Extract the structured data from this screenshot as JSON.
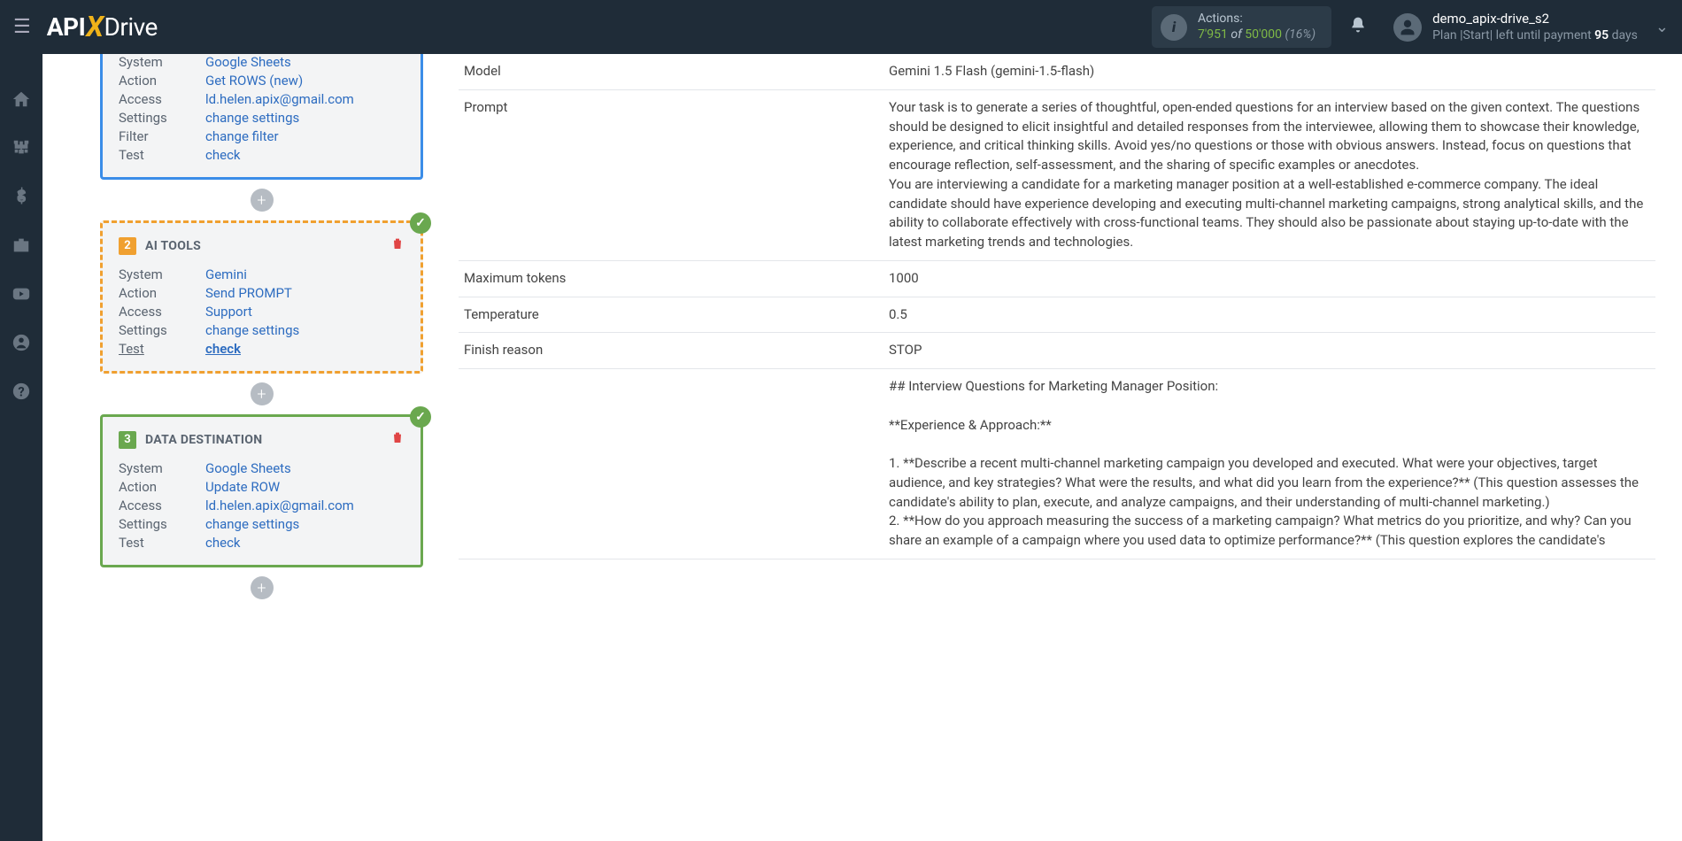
{
  "header": {
    "actions_label": "Actions:",
    "actions_used": "7'951",
    "actions_of": " of ",
    "actions_total": "50'000",
    "actions_pct": " (16%)",
    "user_name": "demo_apix-drive_s2",
    "user_plan_prefix": "Plan |Start| left until payment ",
    "user_plan_days": "95",
    "user_plan_suffix": " days"
  },
  "cards": {
    "c1": {
      "system_label": "System",
      "system_value": "Google Sheets",
      "action_label": "Action",
      "action_value": "Get ROWS (new)",
      "access_label": "Access",
      "access_value": "ld.helen.apix@gmail.com",
      "settings_label": "Settings",
      "settings_value": "change settings",
      "filter_label": "Filter",
      "filter_value": "change filter",
      "test_label": "Test",
      "test_value": "check"
    },
    "c2": {
      "num": "2",
      "title": "AI TOOLS",
      "system_label": "System",
      "system_value": "Gemini",
      "action_label": "Action",
      "action_value": "Send PROMPT",
      "access_label": "Access",
      "access_value": "Support",
      "settings_label": "Settings",
      "settings_value": "change settings",
      "test_label": "Test",
      "test_value": "check"
    },
    "c3": {
      "num": "3",
      "title": "DATA DESTINATION",
      "system_label": "System",
      "system_value": "Google Sheets",
      "action_label": "Action",
      "action_value": "Update ROW",
      "access_label": "Access",
      "access_value": "ld.helen.apix@gmail.com",
      "settings_label": "Settings",
      "settings_value": "change settings",
      "test_label": "Test",
      "test_value": "check"
    }
  },
  "details": {
    "model_label": "Model",
    "model_value": "Gemini 1.5 Flash (gemini-1.5-flash)",
    "prompt_label": "Prompt",
    "prompt_value": "Your task is to generate a series of thoughtful, open-ended questions for an interview based on the given context. The questions should be designed to elicit insightful and detailed responses from the interviewee, allowing them to showcase their knowledge, experience, and critical thinking skills. Avoid yes/no questions or those with obvious answers. Instead, focus on questions that encourage reflection, self-assessment, and the sharing of specific examples or anecdotes.\nYou are interviewing a candidate for a marketing manager position at a well-established e-commerce company. The ideal candidate should have experience developing and executing multi-channel marketing campaigns, strong analytical skills, and the ability to collaborate effectively with cross-functional teams. They should also be passionate about staying up-to-date with the latest marketing trends and technologies.",
    "max_tokens_label": "Maximum tokens",
    "max_tokens_value": "1000",
    "temp_label": "Temperature",
    "temp_value": "0.5",
    "finish_label": "Finish reason",
    "finish_value": "STOP",
    "result_text": "## Interview Questions for Marketing Manager Position:\n\n**Experience & Approach:**\n\n1. **Describe a recent multi-channel marketing campaign you developed and executed. What were your objectives, target audience, and key strategies? What were the results, and what did you learn from the experience?** (This question assesses the candidate's ability to plan, execute, and analyze campaigns, and their understanding of multi-channel marketing.)\n2. **How do you approach measuring the success of a marketing campaign? What metrics do you prioritize, and why? Can you share an example of a campaign where you used data to optimize performance?** (This question explores the candidate's"
  }
}
